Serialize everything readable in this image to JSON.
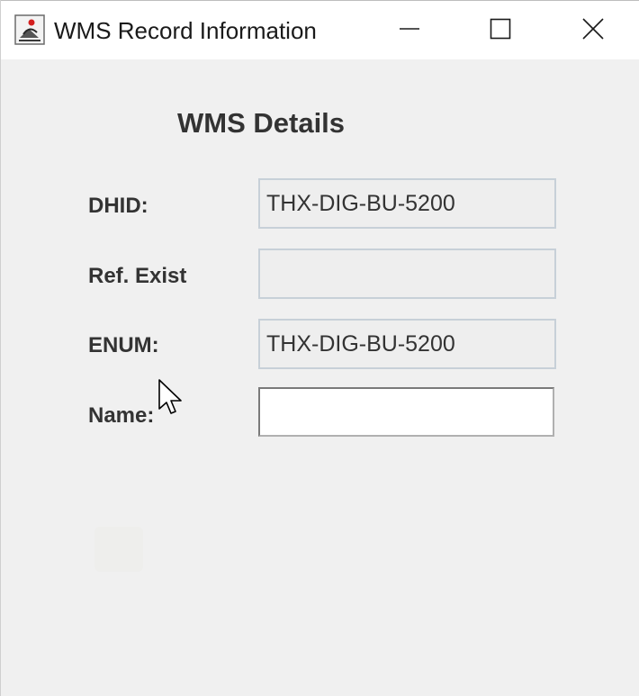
{
  "window": {
    "title": "WMS Record Information",
    "controls": {
      "minimize_icon": "minimize-icon",
      "maximize_icon": "maximize-icon",
      "close_icon": "close-icon"
    }
  },
  "form": {
    "heading": "WMS Details",
    "fields": [
      {
        "label": "DHID:",
        "value": "THX-DIG-BU-5200",
        "editable": false
      },
      {
        "label": "Ref. Exist",
        "value": "",
        "editable": false
      },
      {
        "label": "ENUM:",
        "value": "THX-DIG-BU-5200",
        "editable": false
      },
      {
        "label": "Name:",
        "value": "",
        "editable": true
      }
    ]
  },
  "colors": {
    "window_bg": "#f0f0f0",
    "titlebar_bg": "#ffffff",
    "text": "#333333",
    "readonly_field_bg": "#eeeeee",
    "readonly_field_border": "#c7d0d8"
  }
}
